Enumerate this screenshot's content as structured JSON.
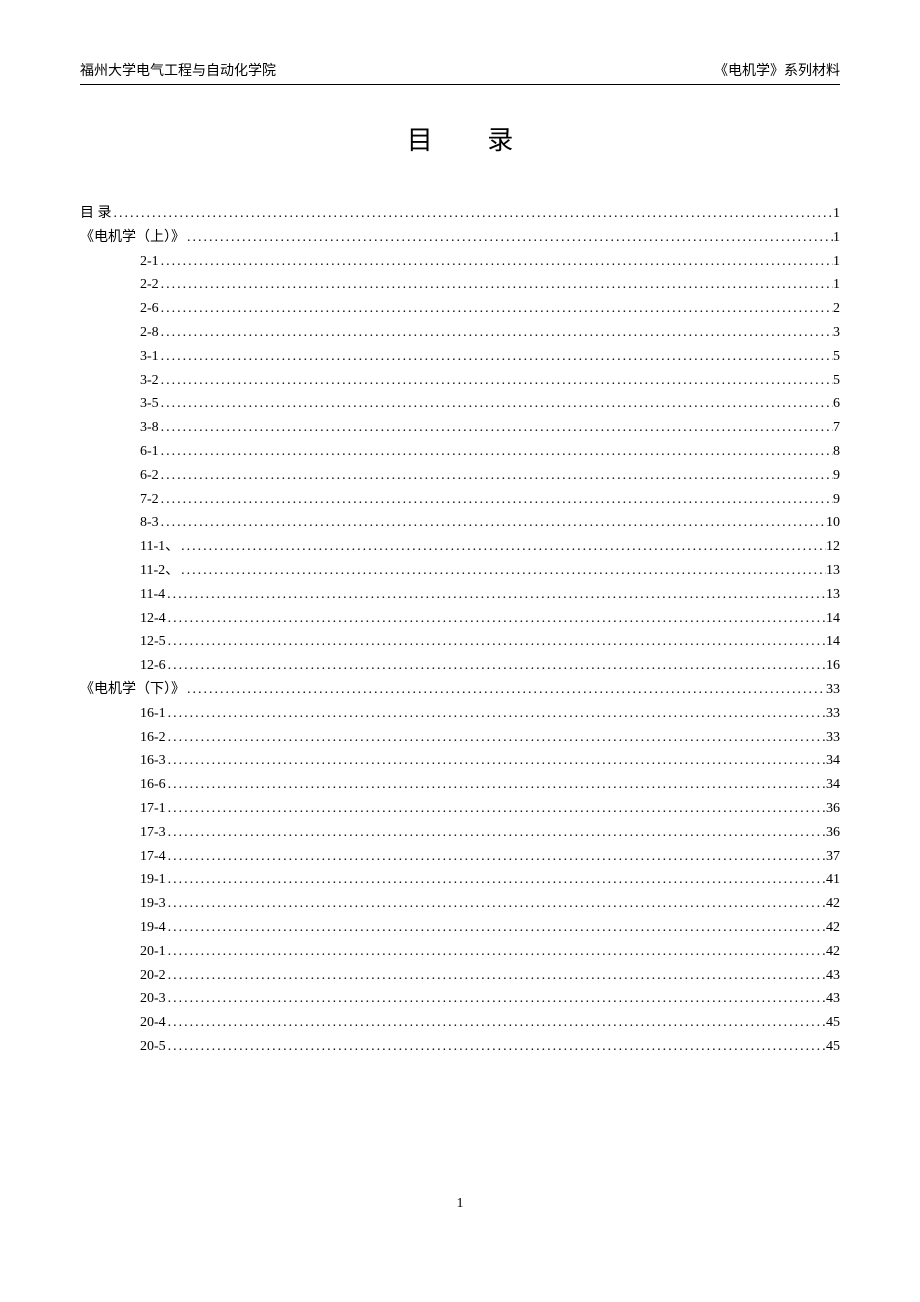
{
  "header": {
    "left": "福州大学电气工程与自动化学院",
    "right": "《电机学》系列材料"
  },
  "title": "目 录",
  "toc": [
    {
      "level": 0,
      "label": "目  录",
      "page": "1"
    },
    {
      "level": 0,
      "label": "《电机学（上）》",
      "page": "1"
    },
    {
      "level": 1,
      "label": "2-1",
      "page": "1"
    },
    {
      "level": 1,
      "label": "2-2",
      "page": "1"
    },
    {
      "level": 1,
      "label": "2-6",
      "page": "2"
    },
    {
      "level": 1,
      "label": "2-8",
      "page": "3"
    },
    {
      "level": 1,
      "label": "3-1",
      "page": "5"
    },
    {
      "level": 1,
      "label": "3-2",
      "page": "5"
    },
    {
      "level": 1,
      "label": "3-5",
      "page": "6"
    },
    {
      "level": 1,
      "label": "3-8",
      "page": "7"
    },
    {
      "level": 1,
      "label": "6-1",
      "page": "8"
    },
    {
      "level": 1,
      "label": "6-2",
      "page": "9"
    },
    {
      "level": 1,
      "label": "7-2",
      "page": "9"
    },
    {
      "level": 1,
      "label": "8-3",
      "page": "10"
    },
    {
      "level": 1,
      "label": "11-1、",
      "page": "12"
    },
    {
      "level": 1,
      "label": "11-2、",
      "page": "13"
    },
    {
      "level": 1,
      "label": "11-4",
      "page": "13"
    },
    {
      "level": 1,
      "label": "12-4",
      "page": "14"
    },
    {
      "level": 1,
      "label": "12-5",
      "page": "14"
    },
    {
      "level": 1,
      "label": "12-6",
      "page": "16"
    },
    {
      "level": 0,
      "label": "《电机学（下）》",
      "page": "33"
    },
    {
      "level": 1,
      "label": "16-1",
      "page": "33"
    },
    {
      "level": 1,
      "label": "16-2",
      "page": "33"
    },
    {
      "level": 1,
      "label": "16-3",
      "page": "34"
    },
    {
      "level": 1,
      "label": "16-6",
      "page": "34"
    },
    {
      "level": 1,
      "label": "17-1",
      "page": "36"
    },
    {
      "level": 1,
      "label": "17-3",
      "page": "36"
    },
    {
      "level": 1,
      "label": "17-4",
      "page": "37"
    },
    {
      "level": 1,
      "label": "19-1",
      "page": "41"
    },
    {
      "level": 1,
      "label": "19-3",
      "page": "42"
    },
    {
      "level": 1,
      "label": "19-4",
      "page": "42"
    },
    {
      "level": 1,
      "label": "20-1",
      "page": "42"
    },
    {
      "level": 1,
      "label": "20-2",
      "page": "43"
    },
    {
      "level": 1,
      "label": "20-3",
      "page": "43"
    },
    {
      "level": 1,
      "label": "20-4",
      "page": "45"
    },
    {
      "level": 1,
      "label": "20-5",
      "page": "45"
    }
  ],
  "pageNumber": "1"
}
